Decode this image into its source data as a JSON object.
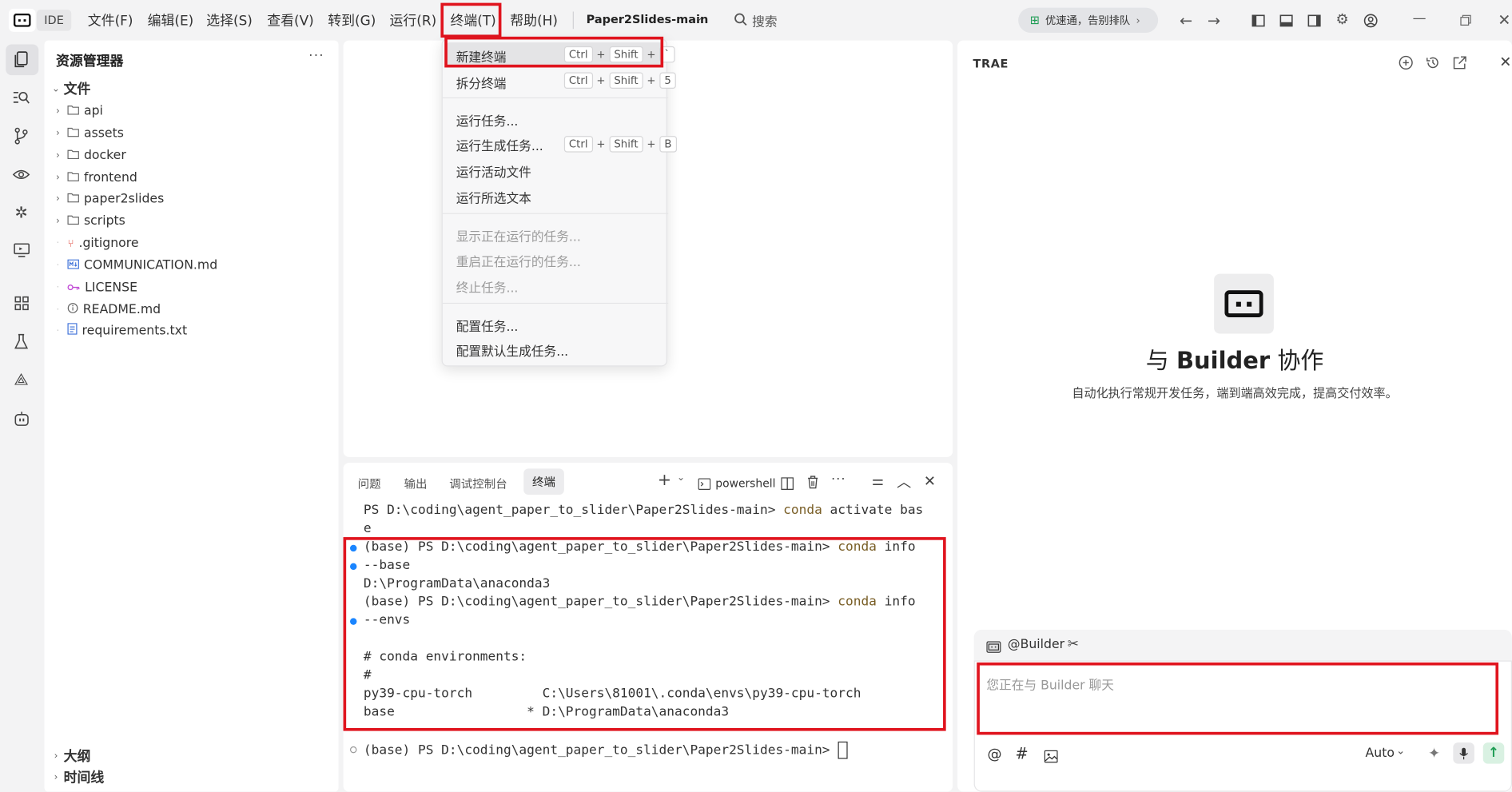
{
  "topbar": {
    "app_label": "IDE",
    "menus": [
      "文件(F)",
      "编辑(E)",
      "选择(S)",
      "查看(V)",
      "转到(G)",
      "运行(R)",
      "终端(T)",
      "帮助(H)"
    ],
    "project": "Paper2Slides-main",
    "search_label": "搜索",
    "promo": "优速通，告别排队"
  },
  "explorer": {
    "title": "资源管理器",
    "root": "文件",
    "folders": [
      "api",
      "assets",
      "docker",
      "frontend",
      "paper2slides",
      "scripts"
    ],
    "files": [
      ".gitignore",
      "COMMUNICATION.md",
      "LICENSE",
      "README.md",
      "requirements.txt"
    ],
    "outline": "大纲",
    "timeline": "时间线"
  },
  "terminal_menu": {
    "items": [
      {
        "label": "新建终端",
        "shortcut": [
          "Ctrl",
          "Shift",
          "`"
        ]
      },
      {
        "label": "拆分终端",
        "shortcut": [
          "Ctrl",
          "Shift",
          "5"
        ]
      },
      {
        "label": "运行任务..."
      },
      {
        "label": "运行生成任务...",
        "shortcut": [
          "Ctrl",
          "Shift",
          "B"
        ]
      },
      {
        "label": "运行活动文件"
      },
      {
        "label": "运行所选文本"
      },
      {
        "label": "显示正在运行的任务...",
        "disabled": true
      },
      {
        "label": "重启正在运行的任务...",
        "disabled": true
      },
      {
        "label": "终止任务...",
        "disabled": true
      },
      {
        "label": "配置任务..."
      },
      {
        "label": "配置默认生成任务..."
      }
    ]
  },
  "panel": {
    "tabs": [
      "问题",
      "输出",
      "调试控制台",
      "终端"
    ],
    "active_tab": "终端",
    "shell": "powershell"
  },
  "terminal_lines": [
    {
      "text": "PS D:\\coding\\agent_paper_to_slider\\Paper2Slides-main> ",
      "cmd": "conda",
      "rest": " activate bas"
    },
    {
      "text": "e"
    },
    {
      "text": "(base) PS D:\\coding\\agent_paper_to_slider\\Paper2Slides-main> ",
      "cmd": "conda",
      "rest": " info"
    },
    {
      "text": "--base"
    },
    {
      "text": "D:\\ProgramData\\anaconda3"
    },
    {
      "text": "(base) PS D:\\coding\\agent_paper_to_slider\\Paper2Slides-main> ",
      "cmd": "conda",
      "rest": " info"
    },
    {
      "text": "--envs"
    },
    {
      "text": ""
    },
    {
      "text": "# conda environments:"
    },
    {
      "text": "#"
    },
    {
      "text": "py39-cpu-torch         C:\\Users\\81001\\.conda\\envs\\py39-cpu-torch"
    },
    {
      "text": "base                 * D:\\ProgramData\\anaconda3"
    },
    {
      "text": ""
    },
    {
      "text": "(base) PS D:\\coding\\agent_paper_to_slider\\Paper2Slides-main> "
    }
  ],
  "trae": {
    "label": "TRAE",
    "heading_prefix": "与 ",
    "heading_bold": "Builder",
    "heading_suffix": " 协作",
    "subtitle": "自动化执行常规开发任务，端到端高效完成，提高交付效率。",
    "chat_agent": "@Builder",
    "chat_placeholder": "您正在与 Builder 聊天",
    "model": "Auto"
  },
  "colors": {
    "highlight_red": "#e0141e",
    "accent_blue": "#1a85ff",
    "promo_green": "#1f9d55"
  }
}
